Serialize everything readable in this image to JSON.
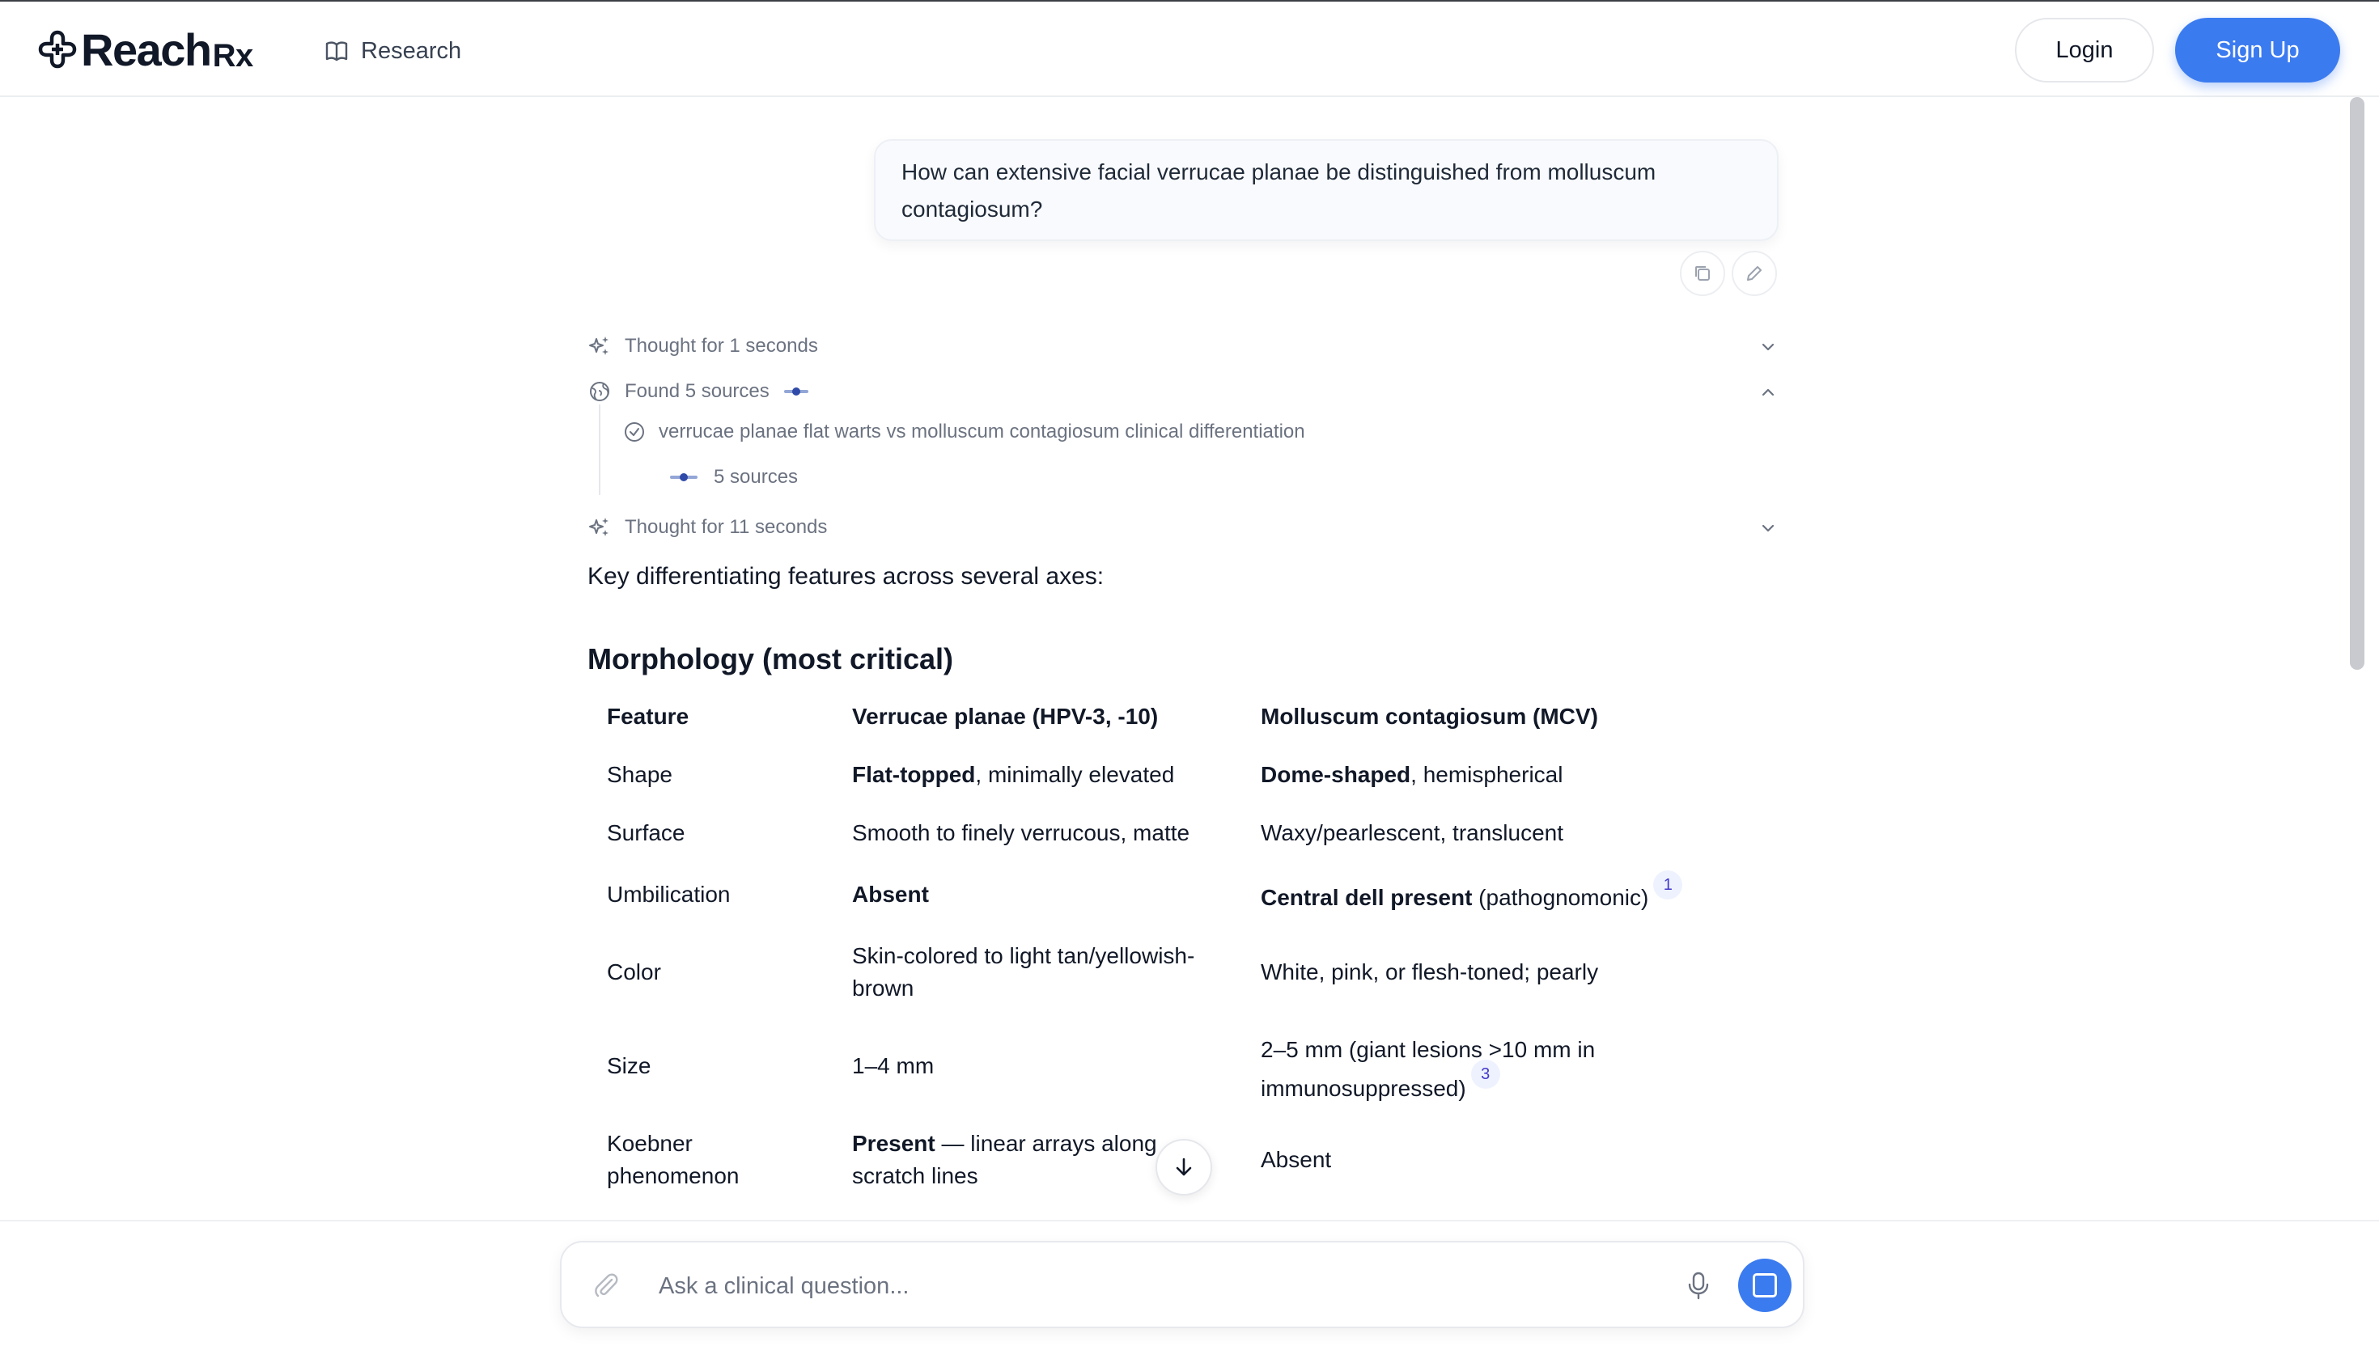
{
  "header": {
    "logo_text": "Reach",
    "logo_suffix": "Rx",
    "nav_research": "Research",
    "login_label": "Login",
    "signup_label": "Sign Up"
  },
  "conversation": {
    "user_message": "How can extensive facial verrucae planae be distinguished from molluscum contagiosum?",
    "steps": {
      "thought_1": "Thought for 1 seconds",
      "found_sources": "Found 5 sources",
      "search_query": "verrucae planae flat warts vs molluscum contagiosum clinical differentiation",
      "sources_count": "5 sources",
      "thought_2": "Thought for 11 seconds"
    },
    "answer": {
      "intro": "Key differentiating features across several axes:",
      "section_title": "Morphology (most critical)",
      "table": {
        "headers": [
          "Feature",
          "Verrucae planae (HPV-3, -10)",
          "Molluscum contagiosum (MCV)"
        ],
        "rows": [
          {
            "feature": "Shape",
            "vp_bold": "Flat-topped",
            "vp_rest": ", minimally elevated",
            "mc_bold": "Dome-shaped",
            "mc_rest": ", hemispherical"
          },
          {
            "feature": "Surface",
            "vp_rest": "Smooth to finely verrucous, matte",
            "mc_rest": "Waxy/pearlescent, translucent"
          },
          {
            "feature": "Umbilication",
            "vp_bold": "Absent",
            "mc_bold": "Central dell present",
            "mc_rest": " (pathognomonic)",
            "mc_cite": "1"
          },
          {
            "feature": "Color",
            "vp_rest": "Skin-colored to light tan/yellowish-brown",
            "mc_rest": "White, pink, or flesh-toned; pearly"
          },
          {
            "feature": "Size",
            "vp_rest": "1–4 mm",
            "mc_rest": "2–5 mm (giant lesions >10 mm in immunosuppressed)",
            "mc_cite": "3"
          },
          {
            "feature": "Koebner phenomenon",
            "vp_bold": "Present",
            "vp_rest": " — linear arrays along scratch lines",
            "mc_rest": "Absent"
          }
        ]
      }
    }
  },
  "composer": {
    "placeholder": "Ask a clinical question..."
  },
  "colors": {
    "accent": "#3b7bf0",
    "citation_bg": "#eef2ff",
    "citation_text": "#4338ca"
  },
  "icons": [
    "logo-icon",
    "book-icon",
    "copy-icon",
    "edit-icon",
    "sparkle-icon",
    "globe-icon",
    "check-circle-icon",
    "chevron-down-icon",
    "chevron-up-icon",
    "arrow-down-icon",
    "paperclip-icon",
    "microphone-icon",
    "stop-icon"
  ]
}
